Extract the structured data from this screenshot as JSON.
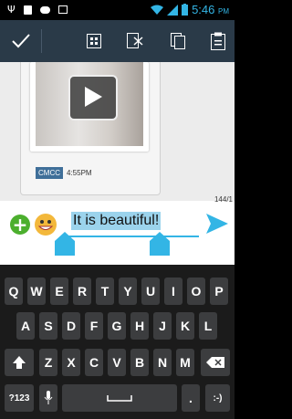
{
  "status_bar": {
    "time": "5:46",
    "ampm": "PM"
  },
  "action_bar": {
    "done_icon": "check-icon",
    "buttons": [
      "grid-icon",
      "attach-icon",
      "copy-icon",
      "clipboard-icon"
    ]
  },
  "message": {
    "sender_tag": "CMCC",
    "time": "4:55PM",
    "attachment": "video-thumbnail"
  },
  "compose": {
    "counter": "144/1",
    "text": "It is beautiful!"
  },
  "colors": {
    "accent": "#33b5e5",
    "actionbar": "#2a3a48",
    "selection": "#9bd3ec"
  },
  "keyboard": {
    "row1": [
      "Q",
      "W",
      "E",
      "R",
      "T",
      "Y",
      "U",
      "I",
      "O",
      "P"
    ],
    "row2": [
      "A",
      "S",
      "D",
      "F",
      "G",
      "H",
      "J",
      "K",
      "L"
    ],
    "row3": [
      "Z",
      "X",
      "C",
      "V",
      "B",
      "N",
      "M"
    ],
    "symbols_label": "?123",
    "period": ".",
    "emoticon": ":-)"
  }
}
